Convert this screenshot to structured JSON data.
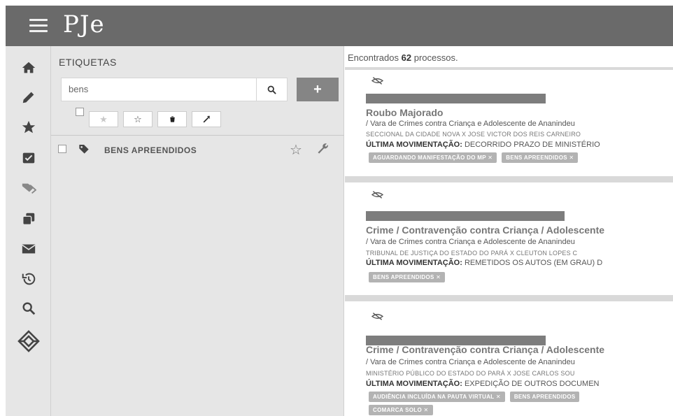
{
  "app": {
    "logo": "PJe"
  },
  "nav": {
    "icons": [
      "home-icon",
      "pencil-icon",
      "star-icon",
      "inbox-check-icon",
      "tags-icon",
      "copy-icon",
      "envelope-icon",
      "history-icon",
      "search-icon",
      "network-icon"
    ]
  },
  "tags_panel": {
    "title": "ETIQUETAS",
    "search_value": "bens",
    "add_label": "+",
    "tags": [
      {
        "label": "BENS APREENDIDOS"
      }
    ]
  },
  "results": {
    "count_prefix": "Encontrados",
    "count": "62",
    "count_suffix": "processos.",
    "last_move_label": "ÚLTIMA MOVIMENTAÇÃO:",
    "items": [
      {
        "title": "Roubo Majorado",
        "court": "/ Vara de Crimes contra Criança e Adolescente de Ananindeu",
        "parties": "SECCIONAL DA CIDADE NOVA X JOSE VICTOR DOS REIS CARNEIRO",
        "last_move": "DECORRIDO PRAZO DE MINISTÉRIO",
        "chips": [
          "AGUARDANDO MANIFESTAÇÃO DO MP ✕",
          "BENS APREENDIDOS ✕"
        ]
      },
      {
        "title": "Crime / Contravenção contra Criança / Adolescente",
        "court": "/ Vara de Crimes contra Criança e Adolescente de Ananindeu",
        "parties": "TRIBUNAL DE JUSTIÇA DO ESTADO DO PARÁ X CLEUTON LOPES C",
        "last_move": "REMETIDOS OS AUTOS (EM GRAU) D",
        "chips": [
          "BENS APREENDIDOS ✕"
        ]
      },
      {
        "title": "Crime / Contravenção contra Criança / Adolescente",
        "court": "/ Vara de Crimes contra Criança e Adolescente de Ananindeu",
        "parties": "MINISTÉRIO PÚBLICO DO ESTADO DO PARÁ X JOSE CARLOS SOU",
        "last_move": "EXPEDIÇÃO DE OUTROS DOCUMEN",
        "chips": [
          "AUDIÊNCIA INCLUÍDA NA PAUTA VIRTUAL ✕",
          "BENS APREENDIDOS",
          "COMARCA SOLO ✕"
        ]
      }
    ]
  }
}
